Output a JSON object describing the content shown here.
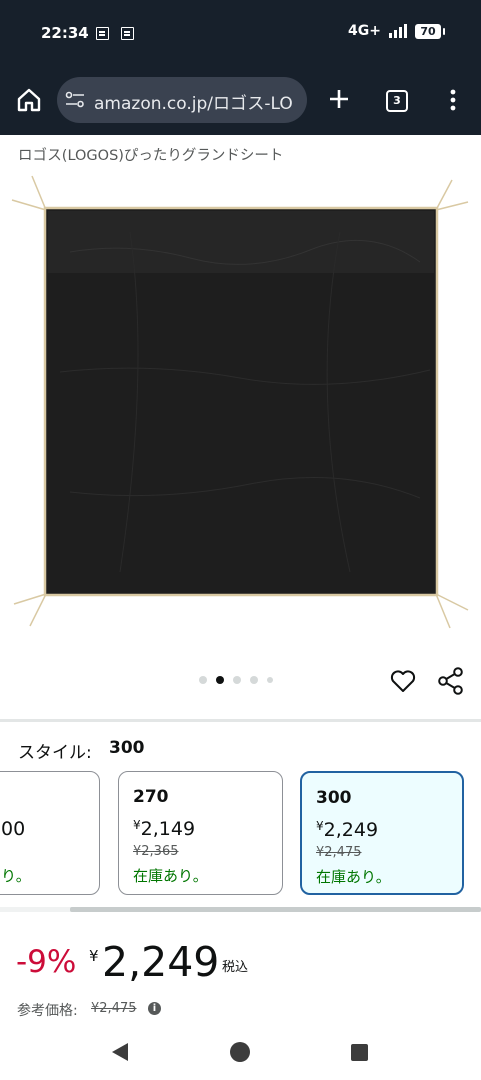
{
  "status_bar": {
    "time": "22:34",
    "network": "4G+",
    "battery": "70"
  },
  "browser": {
    "url": "amazon.co.jp/ロゴス-LO",
    "tab_count": "3"
  },
  "product": {
    "title": "ロゴス(LOGOS)ぴったりグランドシート",
    "image": {
      "type": "black ground sheet with beige straps",
      "colors": {
        "sheet": "#1c1c1c",
        "trim": "#d9c9a3"
      }
    },
    "carousel": {
      "total": 5,
      "active_index": 1
    }
  },
  "style_selector": {
    "label": "スタイル:",
    "selected_value": "300",
    "options": [
      {
        "size": "",
        "price": "00",
        "list_price": "",
        "stock": "り。"
      },
      {
        "size": "270",
        "price_symbol": "¥",
        "price": "2,149",
        "list_price": "¥2,365",
        "stock": "在庫あり。"
      },
      {
        "size": "300",
        "price_symbol": "¥",
        "price": "2,249",
        "list_price": "¥2,475",
        "stock": "在庫あり。",
        "selected": true
      }
    ]
  },
  "pricing": {
    "discount": "-9%",
    "currency": "¥",
    "price": "2,249",
    "tax_label": "税込",
    "reference_label": "参考価格:",
    "reference_price": "¥2,475",
    "info_icon": "i"
  },
  "colors": {
    "accent": "#2162a1",
    "discount": "#cc0c39",
    "stock": "#007600",
    "topbar": "#17202b"
  }
}
